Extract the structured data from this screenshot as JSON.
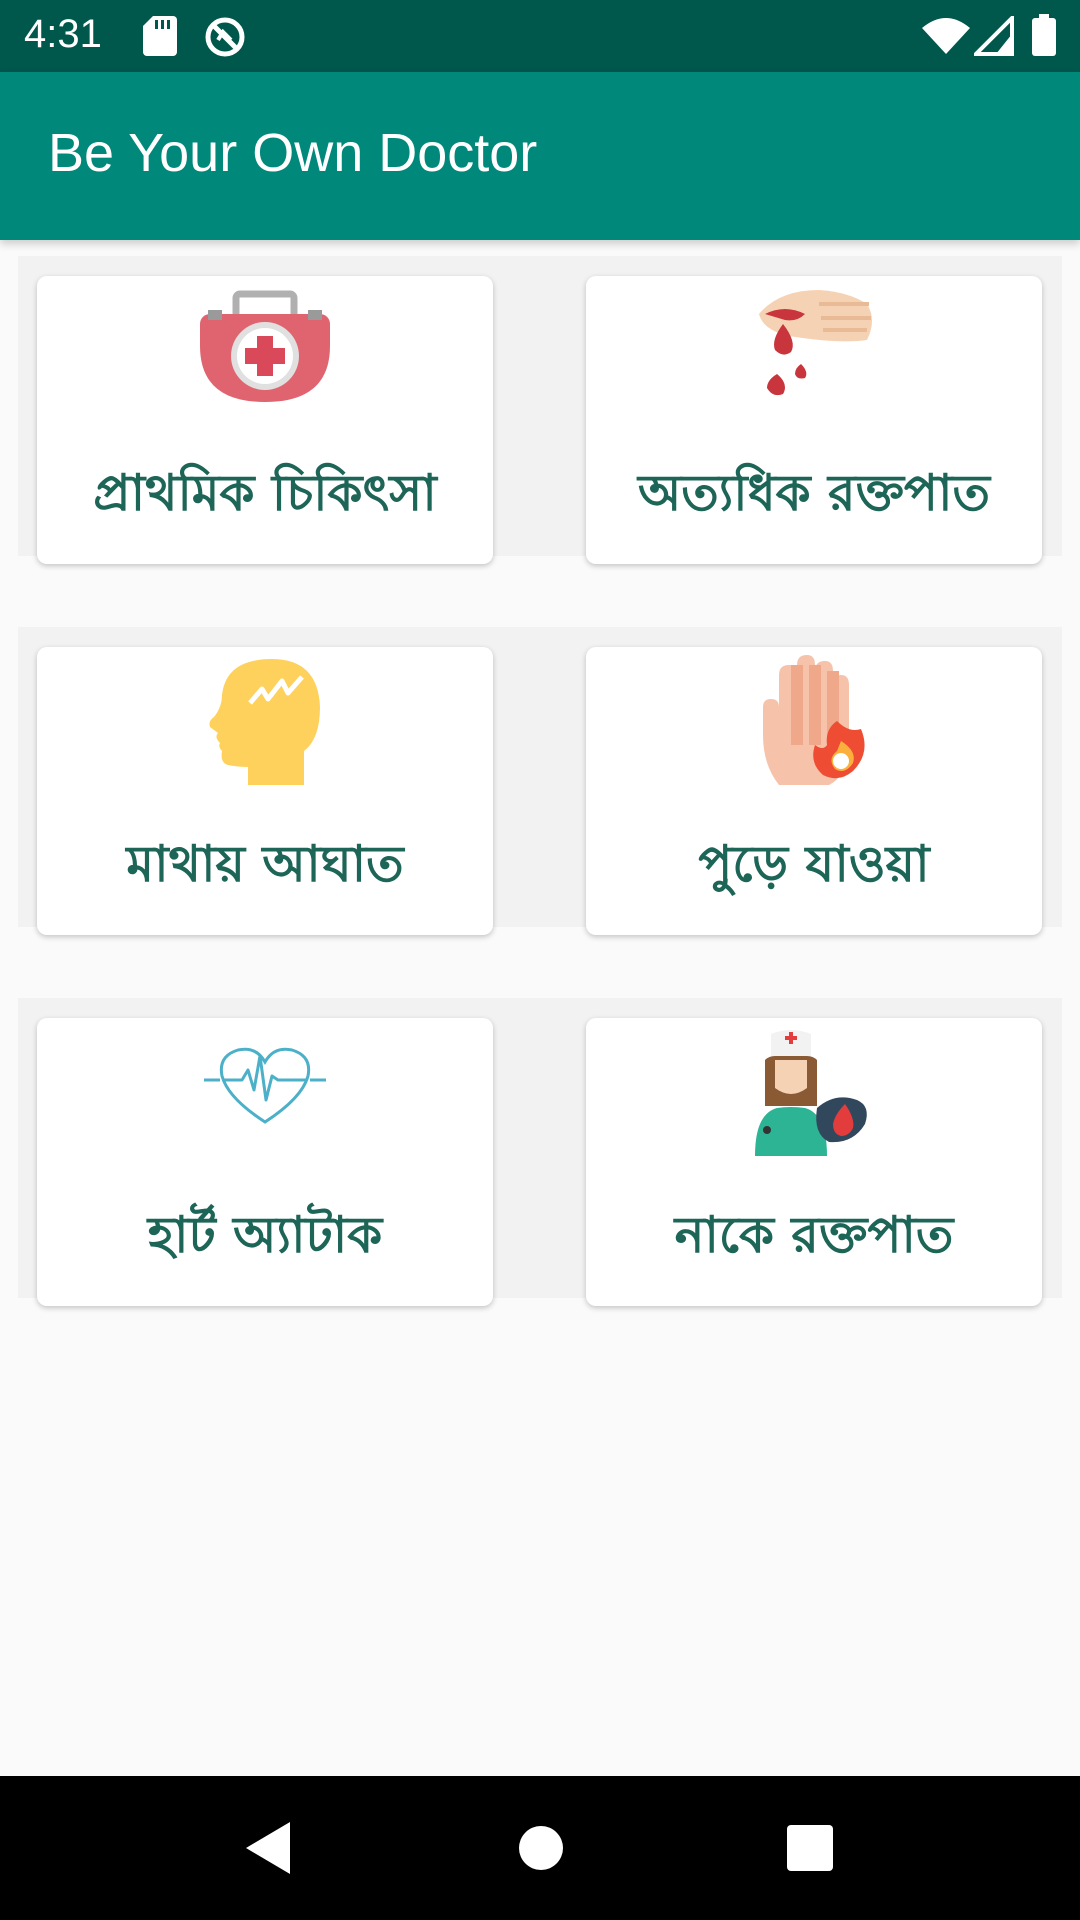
{
  "status_bar": {
    "time": "4:31",
    "icons": [
      "sd-card-icon",
      "do-not-disturb-icon",
      "wifi-icon",
      "signal-icon",
      "battery-icon"
    ]
  },
  "app_bar": {
    "title": "Be Your Own Doctor",
    "color": "#00897b"
  },
  "cards": [
    {
      "label": "প্রাথমিক চিকিৎসা",
      "icon": "first-aid-kit-icon"
    },
    {
      "label": "অত্যধিক রক্তপাত",
      "icon": "bleeding-hand-icon"
    },
    {
      "label": "মাথায় আঘাত",
      "icon": "head-injury-icon"
    },
    {
      "label": "পুড়ে যাওয়া",
      "icon": "burned-hand-icon"
    },
    {
      "label": "হার্ট অ্যাটাক",
      "icon": "heart-pulse-icon"
    },
    {
      "label": "নাকে রক্তপাত",
      "icon": "nurse-blood-icon"
    }
  ],
  "nav_bar": {
    "icons": [
      "back-icon",
      "home-icon",
      "recents-icon"
    ]
  }
}
